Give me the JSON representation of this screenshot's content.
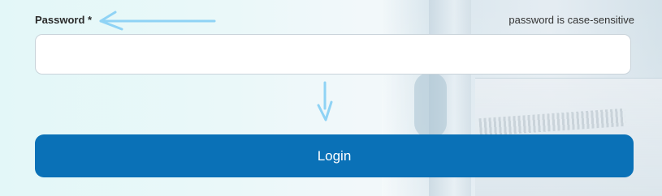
{
  "form": {
    "password_label": "Password *",
    "password_hint": "password is case-sensitive",
    "password_value": "",
    "login_button": "Login"
  },
  "colors": {
    "accent": "#0a71b7",
    "annotation": "#8fd3f5"
  },
  "annotations": {
    "arrow_left_icon": "arrow-left-icon",
    "arrow_down_icon": "arrow-down-icon"
  }
}
